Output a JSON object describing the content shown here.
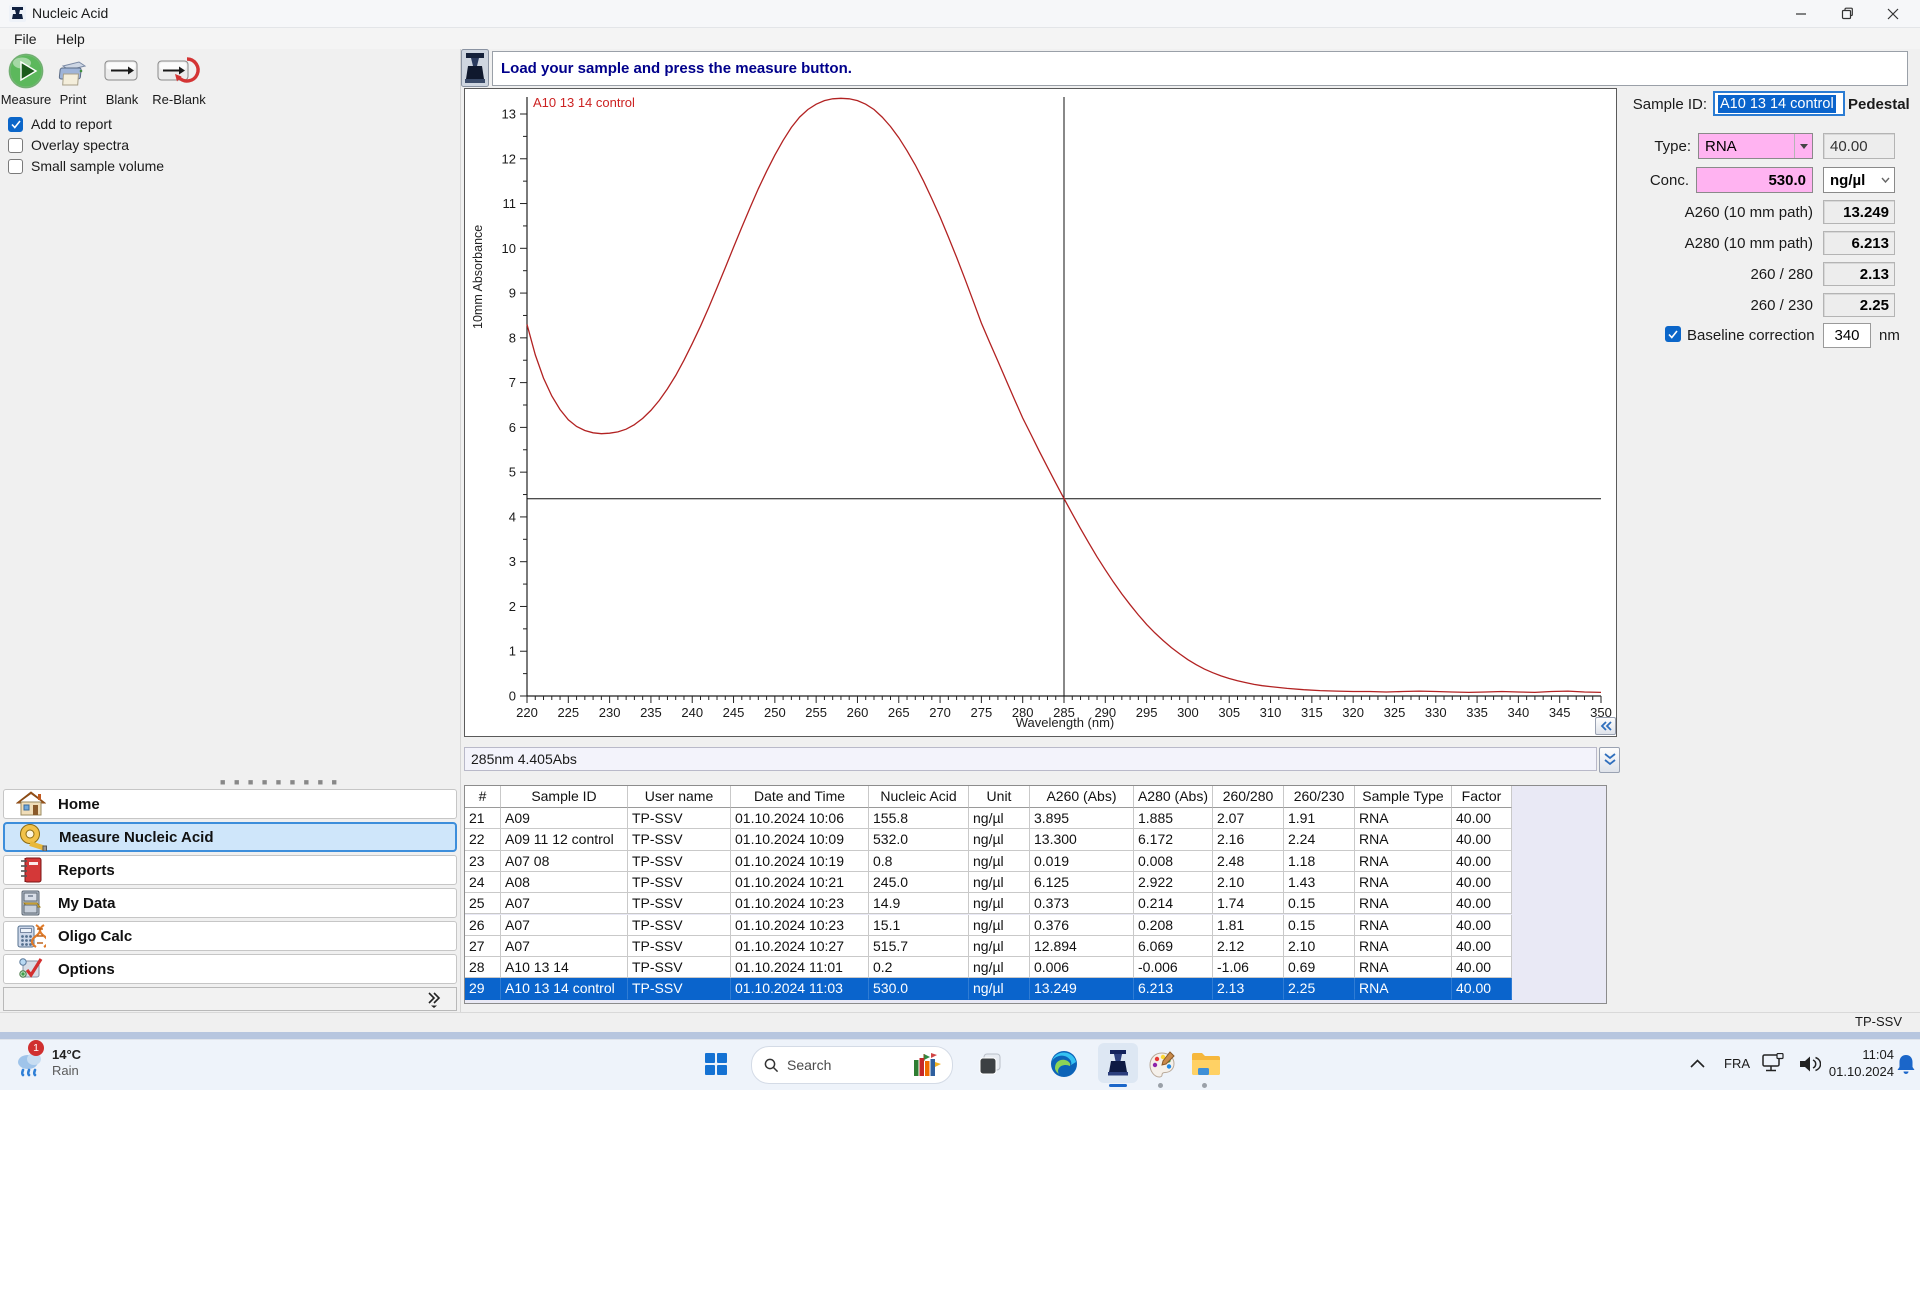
{
  "window": {
    "title": "Nucleic Acid",
    "menu": [
      "File",
      "Help"
    ],
    "status_user": "TP-SSV"
  },
  "toolbar": {
    "buttons": [
      {
        "id": "measure",
        "label": "Measure",
        "icon": "measure-icon"
      },
      {
        "id": "print",
        "label": "Print",
        "icon": "print-icon"
      },
      {
        "id": "blank",
        "label": "Blank",
        "icon": "blank-icon"
      },
      {
        "id": "reblank",
        "label": "Re-Blank",
        "icon": "reblank-icon"
      }
    ],
    "checkboxes": [
      {
        "label": "Add to report",
        "checked": true
      },
      {
        "label": "Overlay spectra",
        "checked": false
      },
      {
        "label": "Small sample volume",
        "checked": false
      }
    ]
  },
  "message_bar": {
    "text": "Load your sample and press the measure button."
  },
  "chart_data": {
    "type": "line",
    "title": "",
    "xlabel": "Wavelength (nm)",
    "ylabel": "10mm Absorbance",
    "xlim": [
      220,
      350
    ],
    "ylim": [
      0,
      13
    ],
    "x_tick_label_step": 5,
    "x_tick_minor_step": 1,
    "y_tick_label_step": 1,
    "y_tick_minor_step": 0.5,
    "grid": false,
    "legend_position": "top-left",
    "cursor": {
      "wavelength_nm": 285,
      "absorbance": 4.405,
      "status_text": "285nm 4.405Abs"
    },
    "series": [
      {
        "name": "A10 13 14 control",
        "color": "#b22222",
        "points": [
          [
            220,
            8.3
          ],
          [
            221,
            7.62
          ],
          [
            222,
            7.1
          ],
          [
            223,
            6.7
          ],
          [
            224,
            6.4
          ],
          [
            225,
            6.17
          ],
          [
            226,
            6.02
          ],
          [
            227,
            5.93
          ],
          [
            228,
            5.88
          ],
          [
            229,
            5.86
          ],
          [
            230,
            5.87
          ],
          [
            231,
            5.9
          ],
          [
            232,
            5.96
          ],
          [
            233,
            6.06
          ],
          [
            234,
            6.2
          ],
          [
            235,
            6.38
          ],
          [
            236,
            6.6
          ],
          [
            237,
            6.86
          ],
          [
            238,
            7.16
          ],
          [
            239,
            7.5
          ],
          [
            240,
            7.87
          ],
          [
            241,
            8.26
          ],
          [
            242,
            8.68
          ],
          [
            243,
            9.12
          ],
          [
            244,
            9.57
          ],
          [
            245,
            10.02
          ],
          [
            246,
            10.47
          ],
          [
            247,
            10.91
          ],
          [
            248,
            11.33
          ],
          [
            249,
            11.72
          ],
          [
            250,
            12.08
          ],
          [
            251,
            12.41
          ],
          [
            252,
            12.7
          ],
          [
            253,
            12.93
          ],
          [
            254,
            13.1
          ],
          [
            255,
            13.22
          ],
          [
            256,
            13.3
          ],
          [
            257,
            13.34
          ],
          [
            258,
            13.35
          ],
          [
            259,
            13.34
          ],
          [
            260,
            13.3
          ],
          [
            261,
            13.22
          ],
          [
            262,
            13.1
          ],
          [
            263,
            12.93
          ],
          [
            264,
            12.72
          ],
          [
            265,
            12.47
          ],
          [
            266,
            12.18
          ],
          [
            267,
            11.86
          ],
          [
            268,
            11.5
          ],
          [
            269,
            11.11
          ],
          [
            270,
            10.7
          ],
          [
            271,
            10.26
          ],
          [
            272,
            9.8
          ],
          [
            273,
            9.32
          ],
          [
            274,
            8.83
          ],
          [
            275,
            8.33
          ],
          [
            276,
            7.9
          ],
          [
            277,
            7.48
          ],
          [
            278,
            7.05
          ],
          [
            279,
            6.63
          ],
          [
            280,
            6.21
          ],
          [
            281,
            5.84
          ],
          [
            282,
            5.47
          ],
          [
            283,
            5.11
          ],
          [
            284,
            4.76
          ],
          [
            285,
            4.41
          ],
          [
            286,
            4.07
          ],
          [
            287,
            3.74
          ],
          [
            288,
            3.42
          ],
          [
            289,
            3.11
          ],
          [
            290,
            2.82
          ],
          [
            291,
            2.54
          ],
          [
            292,
            2.28
          ],
          [
            293,
            2.04
          ],
          [
            294,
            1.81
          ],
          [
            295,
            1.6
          ],
          [
            296,
            1.41
          ],
          [
            297,
            1.24
          ],
          [
            298,
            1.08
          ],
          [
            299,
            0.94
          ],
          [
            300,
            0.81
          ],
          [
            301,
            0.7
          ],
          [
            302,
            0.6
          ],
          [
            303,
            0.52
          ],
          [
            304,
            0.45
          ],
          [
            305,
            0.39
          ],
          [
            306,
            0.34
          ],
          [
            307,
            0.3
          ],
          [
            308,
            0.26
          ],
          [
            309,
            0.23
          ],
          [
            310,
            0.21
          ],
          [
            312,
            0.17
          ],
          [
            314,
            0.14
          ],
          [
            316,
            0.12
          ],
          [
            318,
            0.11
          ],
          [
            320,
            0.1
          ],
          [
            322,
            0.1
          ],
          [
            324,
            0.09
          ],
          [
            326,
            0.1
          ],
          [
            328,
            0.11
          ],
          [
            330,
            0.1
          ],
          [
            332,
            0.09
          ],
          [
            334,
            0.08
          ],
          [
            336,
            0.09
          ],
          [
            338,
            0.1
          ],
          [
            340,
            0.09
          ],
          [
            342,
            0.08
          ],
          [
            344,
            0.1
          ],
          [
            346,
            0.11
          ],
          [
            348,
            0.09
          ],
          [
            350,
            0.08
          ]
        ]
      }
    ]
  },
  "sample_panel": {
    "sample_id_label": "Sample ID:",
    "sample_id_value": "A10 13 14 control",
    "measure_mode": "Pedestal",
    "type_label": "Type:",
    "type_value": "RNA",
    "type_factor": "40.00",
    "conc_label": "Conc.",
    "conc_value": "530.0",
    "conc_unit": "ng/µl",
    "readouts": [
      {
        "label": "A260 (10 mm path)",
        "value": "13.249"
      },
      {
        "label": "A280 (10 mm path)",
        "value": "6.213"
      },
      {
        "label": "260 / 280",
        "value": "2.13"
      },
      {
        "label": "260 / 230",
        "value": "2.25"
      }
    ],
    "baseline": {
      "label": "Baseline correction",
      "checked": true,
      "value": "340",
      "unit": "nm"
    },
    "accent_pink": "#ffb3f1",
    "selection_blue": "#0a64cc"
  },
  "sidebar": {
    "items": [
      {
        "label": "Home",
        "icon": "home-icon",
        "selected": false
      },
      {
        "label": "Measure Nucleic Acid",
        "icon": "measure-tape-icon",
        "selected": true
      },
      {
        "label": "Reports",
        "icon": "reports-icon",
        "selected": false
      },
      {
        "label": "My Data",
        "icon": "my-data-icon",
        "selected": false
      },
      {
        "label": "Oligo Calc",
        "icon": "oligo-calc-icon",
        "selected": false
      },
      {
        "label": "Options",
        "icon": "options-icon",
        "selected": false
      }
    ]
  },
  "results_table": {
    "columns": [
      "#",
      "Sample ID",
      "User name",
      "Date and Time",
      "Nucleic Acid",
      "Unit",
      "A260 (Abs)",
      "A280 (Abs)",
      "260/280",
      "260/230",
      "Sample Type",
      "Factor"
    ],
    "rows": [
      [
        "21",
        "A09",
        "TP-SSV",
        "01.10.2024 10:06",
        "155.8",
        "ng/µl",
        "3.895",
        "1.885",
        "2.07",
        "1.91",
        "RNA",
        "40.00"
      ],
      [
        "22",
        "A09 11 12 control",
        "TP-SSV",
        "01.10.2024 10:09",
        "532.0",
        "ng/µl",
        "13.300",
        "6.172",
        "2.16",
        "2.24",
        "RNA",
        "40.00"
      ],
      [
        "23",
        "A07 08",
        "TP-SSV",
        "01.10.2024 10:19",
        "0.8",
        "ng/µl",
        "0.019",
        "0.008",
        "2.48",
        "1.18",
        "RNA",
        "40.00"
      ],
      [
        "24",
        "A08",
        "TP-SSV",
        "01.10.2024 10:21",
        "245.0",
        "ng/µl",
        "6.125",
        "2.922",
        "2.10",
        "1.43",
        "RNA",
        "40.00"
      ],
      [
        "25",
        "A07",
        "TP-SSV",
        "01.10.2024 10:23",
        "14.9",
        "ng/µl",
        "0.373",
        "0.214",
        "1.74",
        "0.15",
        "RNA",
        "40.00"
      ],
      [
        "26",
        "A07",
        "TP-SSV",
        "01.10.2024 10:23",
        "15.1",
        "ng/µl",
        "0.376",
        "0.208",
        "1.81",
        "0.15",
        "RNA",
        "40.00"
      ],
      [
        "27",
        "A07",
        "TP-SSV",
        "01.10.2024 10:27",
        "515.7",
        "ng/µl",
        "12.894",
        "6.069",
        "2.12",
        "2.10",
        "RNA",
        "40.00"
      ],
      [
        "28",
        "A10 13 14",
        "TP-SSV",
        "01.10.2024 11:01",
        "0.2",
        "ng/µl",
        "0.006",
        "-0.006",
        "-1.06",
        "0.69",
        "RNA",
        "40.00"
      ],
      [
        "29",
        "A10 13 14 control",
        "TP-SSV",
        "01.10.2024 11:03",
        "530.0",
        "ng/µl",
        "13.249",
        "6.213",
        "2.13",
        "2.25",
        "RNA",
        "40.00"
      ]
    ],
    "selected_row_number": "29"
  },
  "taskbar": {
    "weather": {
      "temperature": "14°C",
      "condition": "Rain",
      "badge_count": "1"
    },
    "search": {
      "placeholder": "Search"
    },
    "active_app": "nanodrop",
    "tray": {
      "language": "FRA",
      "time": "11:04",
      "date": "01.10.2024"
    }
  }
}
